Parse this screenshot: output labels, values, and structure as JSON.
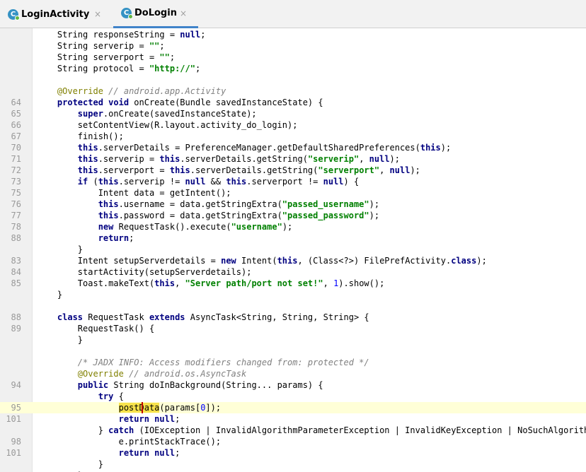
{
  "tabs": [
    {
      "label": "LoginActivity",
      "icon": "C",
      "close": "×",
      "active": false
    },
    {
      "label": "DoLogin",
      "icon": "C",
      "close": "×",
      "active": true
    }
  ],
  "editor": {
    "current_line": "95",
    "lines": [
      {
        "ln": "",
        "tokens": [
          {
            "t": "    String responseString = "
          },
          {
            "t": "null",
            "c": "kw"
          },
          {
            "t": ";"
          }
        ]
      },
      {
        "ln": "",
        "tokens": [
          {
            "t": "    String serverip = "
          },
          {
            "t": "\"\"",
            "c": "str"
          },
          {
            "t": ";"
          }
        ]
      },
      {
        "ln": "",
        "tokens": [
          {
            "t": "    String serverport = "
          },
          {
            "t": "\"\"",
            "c": "str"
          },
          {
            "t": ";"
          }
        ]
      },
      {
        "ln": "",
        "tokens": [
          {
            "t": "    String protocol = "
          },
          {
            "t": "\"http://\"",
            "c": "str"
          },
          {
            "t": ";"
          }
        ]
      },
      {
        "ln": "",
        "tokens": []
      },
      {
        "ln": "",
        "tokens": [
          {
            "t": "    "
          },
          {
            "t": "@Override",
            "c": "ann"
          },
          {
            "t": " "
          },
          {
            "t": "// android.app.Activity",
            "c": "cmt"
          }
        ]
      },
      {
        "ln": "64",
        "tokens": [
          {
            "t": "    "
          },
          {
            "t": "protected void",
            "c": "kw"
          },
          {
            "t": " onCreate(Bundle savedInstanceState) {"
          }
        ]
      },
      {
        "ln": "65",
        "tokens": [
          {
            "t": "        "
          },
          {
            "t": "super",
            "c": "kw"
          },
          {
            "t": ".onCreate(savedInstanceState);"
          }
        ]
      },
      {
        "ln": "66",
        "tokens": [
          {
            "t": "        setContentView(R.layout.activity_do_login);"
          }
        ]
      },
      {
        "ln": "67",
        "tokens": [
          {
            "t": "        finish();"
          }
        ]
      },
      {
        "ln": "70",
        "tokens": [
          {
            "t": "        "
          },
          {
            "t": "this",
            "c": "kw"
          },
          {
            "t": ".serverDetails = PreferenceManager.getDefaultSharedPreferences("
          },
          {
            "t": "this",
            "c": "kw"
          },
          {
            "t": ");"
          }
        ]
      },
      {
        "ln": "71",
        "tokens": [
          {
            "t": "        "
          },
          {
            "t": "this",
            "c": "kw"
          },
          {
            "t": ".serverip = "
          },
          {
            "t": "this",
            "c": "kw"
          },
          {
            "t": ".serverDetails.getString("
          },
          {
            "t": "\"serverip\"",
            "c": "str"
          },
          {
            "t": ", "
          },
          {
            "t": "null",
            "c": "kw"
          },
          {
            "t": ");"
          }
        ]
      },
      {
        "ln": "72",
        "tokens": [
          {
            "t": "        "
          },
          {
            "t": "this",
            "c": "kw"
          },
          {
            "t": ".serverport = "
          },
          {
            "t": "this",
            "c": "kw"
          },
          {
            "t": ".serverDetails.getString("
          },
          {
            "t": "\"serverport\"",
            "c": "str"
          },
          {
            "t": ", "
          },
          {
            "t": "null",
            "c": "kw"
          },
          {
            "t": ");"
          }
        ]
      },
      {
        "ln": "73",
        "tokens": [
          {
            "t": "        "
          },
          {
            "t": "if",
            "c": "kw"
          },
          {
            "t": " ("
          },
          {
            "t": "this",
            "c": "kw"
          },
          {
            "t": ".serverip != "
          },
          {
            "t": "null",
            "c": "kw"
          },
          {
            "t": " && "
          },
          {
            "t": "this",
            "c": "kw"
          },
          {
            "t": ".serverport != "
          },
          {
            "t": "null",
            "c": "kw"
          },
          {
            "t": ") {"
          }
        ]
      },
      {
        "ln": "75",
        "tokens": [
          {
            "t": "            Intent data = getIntent();"
          }
        ]
      },
      {
        "ln": "76",
        "tokens": [
          {
            "t": "            "
          },
          {
            "t": "this",
            "c": "kw"
          },
          {
            "t": ".username = data.getStringExtra("
          },
          {
            "t": "\"passed_username\"",
            "c": "str"
          },
          {
            "t": ");"
          }
        ]
      },
      {
        "ln": "77",
        "tokens": [
          {
            "t": "            "
          },
          {
            "t": "this",
            "c": "kw"
          },
          {
            "t": ".password = data.getStringExtra("
          },
          {
            "t": "\"passed_password\"",
            "c": "str"
          },
          {
            "t": ");"
          }
        ]
      },
      {
        "ln": "78",
        "tokens": [
          {
            "t": "            "
          },
          {
            "t": "new",
            "c": "kw"
          },
          {
            "t": " RequestTask().execute("
          },
          {
            "t": "\"username\"",
            "c": "str"
          },
          {
            "t": ");"
          }
        ]
      },
      {
        "ln": "88",
        "tokens": [
          {
            "t": "            "
          },
          {
            "t": "return",
            "c": "kw"
          },
          {
            "t": ";"
          }
        ]
      },
      {
        "ln": "",
        "tokens": [
          {
            "t": "        }"
          }
        ]
      },
      {
        "ln": "83",
        "tokens": [
          {
            "t": "        Intent setupServerdetails = "
          },
          {
            "t": "new",
            "c": "kw"
          },
          {
            "t": " Intent("
          },
          {
            "t": "this",
            "c": "kw"
          },
          {
            "t": ", (Class<?>) FilePrefActivity."
          },
          {
            "t": "class",
            "c": "kw"
          },
          {
            "t": ");"
          }
        ]
      },
      {
        "ln": "84",
        "tokens": [
          {
            "t": "        startActivity(setupServerdetails);"
          }
        ]
      },
      {
        "ln": "85",
        "tokens": [
          {
            "t": "        Toast.makeText("
          },
          {
            "t": "this",
            "c": "kw"
          },
          {
            "t": ", "
          },
          {
            "t": "\"Server path/port not set!\"",
            "c": "str"
          },
          {
            "t": ", "
          },
          {
            "t": "1",
            "c": "num"
          },
          {
            "t": ").show();"
          }
        ]
      },
      {
        "ln": "",
        "tokens": [
          {
            "t": "    }"
          }
        ]
      },
      {
        "ln": "",
        "tokens": []
      },
      {
        "ln": "88",
        "tokens": [
          {
            "t": "    "
          },
          {
            "t": "class",
            "c": "kw"
          },
          {
            "t": " RequestTask "
          },
          {
            "t": "extends",
            "c": "kw"
          },
          {
            "t": " AsyncTask<String, String, String> {"
          }
        ]
      },
      {
        "ln": "89",
        "tokens": [
          {
            "t": "        RequestTask() {"
          }
        ]
      },
      {
        "ln": "",
        "tokens": [
          {
            "t": "        }"
          }
        ]
      },
      {
        "ln": "",
        "tokens": []
      },
      {
        "ln": "",
        "tokens": [
          {
            "t": "        "
          },
          {
            "t": "/* JADX INFO: Access modifiers changed from: protected */",
            "c": "cmt"
          }
        ]
      },
      {
        "ln": "",
        "tokens": [
          {
            "t": "        "
          },
          {
            "t": "@Override",
            "c": "ann"
          },
          {
            "t": " "
          },
          {
            "t": "// android.os.AsyncTask",
            "c": "cmt"
          }
        ]
      },
      {
        "ln": "94",
        "tokens": [
          {
            "t": "        "
          },
          {
            "t": "public",
            "c": "kw"
          },
          {
            "t": " String doInBackground(String... params) {"
          }
        ]
      },
      {
        "ln": "",
        "tokens": [
          {
            "t": "            "
          },
          {
            "t": "try",
            "c": "kw"
          },
          {
            "t": " {"
          }
        ]
      },
      {
        "ln": "95",
        "tokens": [
          {
            "t": "                "
          },
          {
            "t": "postData",
            "c": "usage"
          },
          {
            "t": "(params["
          },
          {
            "t": "0",
            "c": "num"
          },
          {
            "t": "]);"
          }
        ]
      },
      {
        "ln": "101",
        "tokens": [
          {
            "t": "                "
          },
          {
            "t": "return null",
            "c": "kw"
          },
          {
            "t": ";"
          }
        ]
      },
      {
        "ln": "",
        "tokens": [
          {
            "t": "            } "
          },
          {
            "t": "catch",
            "c": "kw"
          },
          {
            "t": " (IOException | InvalidAlgorithmParameterException | InvalidKeyException | NoSuchAlgorithmException"
          }
        ]
      },
      {
        "ln": "98",
        "tokens": [
          {
            "t": "                e.printStackTrace();"
          }
        ]
      },
      {
        "ln": "101",
        "tokens": [
          {
            "t": "                "
          },
          {
            "t": "return null",
            "c": "kw"
          },
          {
            "t": ";"
          }
        ]
      },
      {
        "ln": "",
        "tokens": [
          {
            "t": "            }"
          }
        ]
      },
      {
        "ln": "",
        "tokens": [
          {
            "t": "        }"
          }
        ]
      }
    ]
  }
}
